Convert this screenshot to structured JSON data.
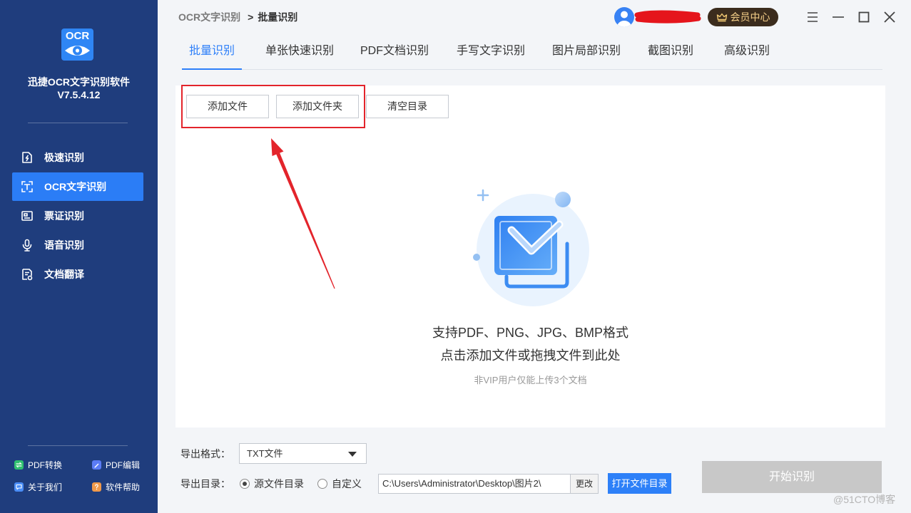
{
  "app": {
    "logo_text": "OCR",
    "name": "迅捷OCR文字识别软件",
    "version": "V7.5.4.12"
  },
  "sidebar": {
    "nav": [
      {
        "label": "极速识别",
        "icon": "lightning-doc-icon",
        "active": false
      },
      {
        "label": "OCR文字识别",
        "icon": "text-scan-icon",
        "active": true
      },
      {
        "label": "票证识别",
        "icon": "id-card-icon",
        "active": false
      },
      {
        "label": "语音识别",
        "icon": "microphone-icon",
        "active": false
      },
      {
        "label": "文档翻译",
        "icon": "translate-doc-icon",
        "active": false
      }
    ],
    "footer_links": [
      {
        "label": "PDF转换",
        "icon": "pdf-convert-icon",
        "color": "#2fbf6f"
      },
      {
        "label": "PDF编辑",
        "icon": "pdf-edit-icon",
        "color": "#5b7cf6"
      },
      {
        "label": "关于我们",
        "icon": "about-icon",
        "color": "#4a8df6"
      },
      {
        "label": "软件帮助",
        "icon": "help-icon",
        "color": "#f0994a"
      }
    ]
  },
  "header": {
    "breadcrumb_parent": "OCR文字识别",
    "breadcrumb_separator": ">",
    "breadcrumb_current": "批量识别",
    "user_icon": "avatar-icon",
    "vip_button": "会员中心",
    "vip_icon": "crown-icon",
    "window_controls": [
      "menu-icon",
      "minimize-icon",
      "maximize-icon",
      "close-icon"
    ]
  },
  "tabs": [
    {
      "label": "批量识别",
      "active": true
    },
    {
      "label": "单张快速识别",
      "active": false
    },
    {
      "label": "PDF文档识别",
      "active": false
    },
    {
      "label": "手写文字识别",
      "active": false
    },
    {
      "label": "图片局部识别",
      "active": false
    },
    {
      "label": "截图识别",
      "active": false
    },
    {
      "label": "高级识别",
      "active": false
    }
  ],
  "toolbar": {
    "add_file": "添加文件",
    "add_folder": "添加文件夹",
    "clear_list": "清空目录"
  },
  "dropzone": {
    "formats": "支持PDF、PNG、JPG、BMP格式",
    "hint": "点击添加文件或拖拽文件到此处",
    "limit_note": "非VIP用户仅能上传3个文档",
    "icon": "upload-documents-icon"
  },
  "export": {
    "format_label": "导出格式：",
    "format_value": "TXT文件",
    "dir_label": "导出目录：",
    "dir_options": [
      {
        "label": "源文件目录",
        "checked": true
      },
      {
        "label": "自定义",
        "checked": false
      }
    ],
    "path": "C:\\Users\\Administrator\\Desktop\\图片2\\",
    "change_button": "更改",
    "open_dir_button": "打开文件目录",
    "start_button": "开始识别"
  },
  "watermark": "@51CTO博客",
  "colors": {
    "sidebar_bg": "#1f3d7d",
    "accent": "#2d7ff9",
    "annotation_red": "#e3242b",
    "vip_bg": "#3b2c1d",
    "vip_text": "#f5cf89",
    "disabled_button": "#c8c8c8"
  }
}
